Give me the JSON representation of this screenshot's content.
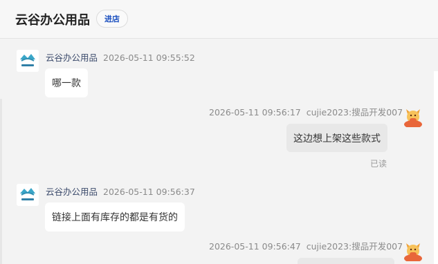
{
  "header": {
    "shop_name": "云谷办公用品",
    "enter_label": "进店"
  },
  "messages": [
    {
      "sender": "云谷办公用品",
      "time": "2026-05-11 09:55:52",
      "text": "哪一款",
      "side": "left"
    },
    {
      "sender": "cujie2023:搜品开发007",
      "time": "2026-05-11 09:56:17",
      "text": "这边想上架这些款式",
      "side": "right",
      "status": "已读"
    },
    {
      "sender": "云谷办公用品",
      "time": "2026-05-11 09:56:37",
      "text": "链接上面有库存的都是有货的",
      "side": "left"
    },
    {
      "sender": "cujie2023:搜品开发007",
      "time": "2026-05-11 09:56:47",
      "text": "",
      "side": "right"
    }
  ],
  "icons": {
    "shop_avatar": "shop-logo-icon",
    "user_avatar": "cow-mascot-icon"
  },
  "colors": {
    "accent": "#1a4fbf",
    "sender_name": "#3b4a6b",
    "user_avatar": "#e8663a"
  }
}
